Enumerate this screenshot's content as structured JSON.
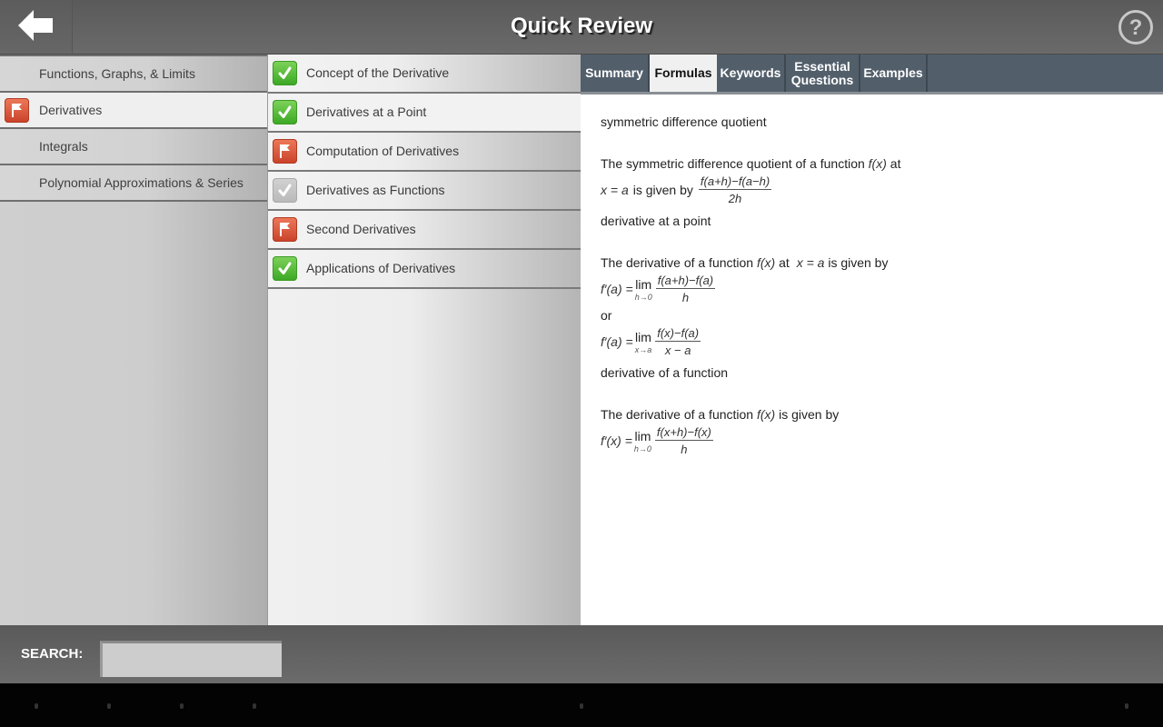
{
  "header": {
    "title": "Quick Review",
    "back_icon": "arrow-left-icon",
    "help_icon": "question-circle-icon"
  },
  "chapters": [
    {
      "label": "Functions, Graphs, & Limits",
      "status": "none",
      "selected": false
    },
    {
      "label": "Derivatives",
      "status": "flag",
      "selected": true
    },
    {
      "label": "Integrals",
      "status": "none",
      "selected": false
    },
    {
      "label": "Polynomial Approximations & Series",
      "status": "none",
      "selected": false
    }
  ],
  "topics": [
    {
      "label": "Concept of the Derivative",
      "status": "check",
      "selected": false
    },
    {
      "label": "Derivatives at a Point",
      "status": "check",
      "selected": true
    },
    {
      "label": "Computation of Derivatives",
      "status": "flag",
      "selected": false
    },
    {
      "label": "Derivatives as Functions",
      "status": "pending",
      "selected": false
    },
    {
      "label": "Second Derivatives",
      "status": "flag",
      "selected": false
    },
    {
      "label": "Applications of Derivatives",
      "status": "check",
      "selected": false
    }
  ],
  "tabs": [
    {
      "label": "Summary",
      "active": false
    },
    {
      "label": "Formulas",
      "active": true
    },
    {
      "label": "Keywords",
      "active": false
    },
    {
      "label": "Essential Questions",
      "active": false
    },
    {
      "label": "Examples",
      "active": false
    }
  ],
  "formulas": {
    "f1_term": "symmetric difference quotient",
    "f1_text_a": "The symmetric difference quotient of a function",
    "f1_text_b": "at",
    "f1_text_c": "is given by",
    "f1_num": "f(a+h)−f(a−h)",
    "f1_den": "2h",
    "f2_term": "derivative at a point",
    "f2_text_a": "The derivative of a function",
    "f2_text_b": "at",
    "f2_text_c": "is given by",
    "f2_lhs": "f′(a) =",
    "f2_lim": "lim",
    "f2_lim_sub": "h→0",
    "f2_num": "f(a+h)−f(a)",
    "f2_den": "h",
    "f2_or": "or",
    "f2b_lhs": "f′(a) =",
    "f2b_lim": "lim",
    "f2b_lim_sub": "x→a",
    "f2b_num": "f(x)−f(a)",
    "f2b_den": "x − a",
    "f3_term": "derivative of a function",
    "f3_text_a": "The derivative of a function",
    "f3_text_c": "is given by",
    "f3_lhs": "f′(x) =",
    "f3_lim": "lim",
    "f3_lim_sub": "h→0",
    "f3_num": "f(x+h)−f(x)",
    "f3_den": "h",
    "fx": "f(x)",
    "xa": "x = a"
  },
  "search": {
    "label": "SEARCH:",
    "value": "",
    "placeholder": ""
  },
  "colors": {
    "tab_bar": "#525f6b",
    "check_green": "#4cb52f",
    "flag_red": "#d9533a",
    "pending_gray": "#c4c4c4"
  }
}
